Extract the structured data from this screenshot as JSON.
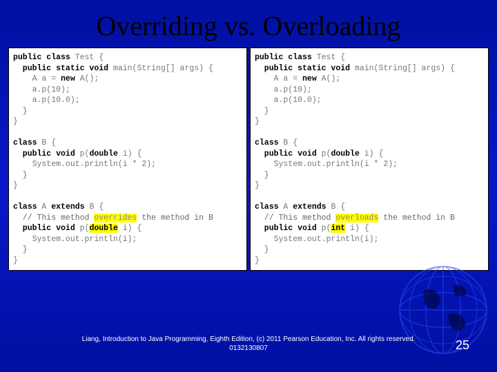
{
  "title": "Overriding vs. Overloading",
  "left_code": {
    "line1a": "public class",
    "line1b": " Test {",
    "line2a": "  public static void",
    "line2b": " main(String[] args) {",
    "line3": "    A a = ",
    "line3b": "new",
    "line3c": " A();",
    "line4": "    a.p(10);",
    "line5": "    a.p(10.0);",
    "line6": "  }",
    "line7": "}",
    "line8": "",
    "line9a": "class",
    "line9b": " B {",
    "line10a": "  public void",
    "line10b": " p(",
    "line10c": "double",
    "line10d": " i) {",
    "line11": "    System.out.println(i * 2);",
    "line12": "  }",
    "line13": "}",
    "line14": "",
    "line15a": "class",
    "line15b": " A ",
    "line15c": "extends",
    "line15d": " B {",
    "line16a": "  // This method ",
    "line16hl": "overrides",
    "line16b": " the method in B",
    "line17a": "  public void",
    "line17b": " p(",
    "line17hl": "double",
    "line17c": " i) {",
    "line18": "    System.out.println(i);",
    "line19": "  }",
    "line20": "}"
  },
  "right_code": {
    "line1a": "public class",
    "line1b": " Test {",
    "line2a": "  public static void",
    "line2b": " main(String[] args) {",
    "line3": "    A a = ",
    "line3b": "new",
    "line3c": " A();",
    "line4": "    a.p(10);",
    "line5": "    a.p(10.0);",
    "line6": "  }",
    "line7": "}",
    "line8": "",
    "line9a": "class",
    "line9b": " B {",
    "line10a": "  public void",
    "line10b": " p(",
    "line10c": "double",
    "line10d": " i) {",
    "line11": "    System.out.println(i * 2);",
    "line12": "  }",
    "line13": "}",
    "line14": "",
    "line15a": "class",
    "line15b": " A ",
    "line15c": "extends",
    "line15d": " B {",
    "line16a": "  // This method ",
    "line16hl": "overloads",
    "line16b": " the method in B",
    "line17a": "  public void",
    "line17b": " p(",
    "line17hl": "int",
    "line17c": " i) {",
    "line18": "    System.out.println(i);",
    "line19": "  }",
    "line20": "}"
  },
  "footer": "Liang, Introduction to Java Programming, Eighth Edition, (c) 2011 Pearson Education, Inc. All rights reserved. 0132130807",
  "page_number": "25"
}
